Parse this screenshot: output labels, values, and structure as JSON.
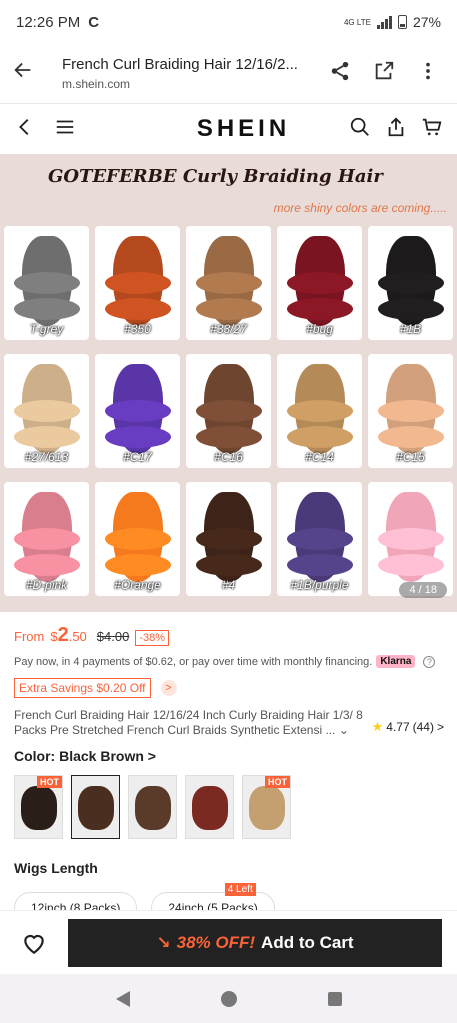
{
  "status_bar": {
    "time": "12:26 PM",
    "carrier_icon": "C",
    "network": "4G LTE",
    "battery": "27%"
  },
  "browser": {
    "page_title": "French Curl Braiding Hair 12/16/2...",
    "domain": "m.shein.com"
  },
  "shein_nav": {
    "logo": "SHEIN"
  },
  "product_image": {
    "banner_title": "GOTEFERBE Curly Braiding Hair",
    "banner_subtitle": "more shiny colors are coming.....",
    "counter": "4 / 18",
    "swatches": [
      {
        "label": "T-grey",
        "color": "#6e6e6e"
      },
      {
        "label": "#350",
        "color": "#b4491e"
      },
      {
        "label": "#33/27",
        "color": "#9a6a45"
      },
      {
        "label": "#bug",
        "color": "#7a1420"
      },
      {
        "label": "#1B",
        "color": "#1c1a1a"
      },
      {
        "label": "#27/613",
        "color": "#cdb08a"
      },
      {
        "label": "#C17",
        "color": "#5a35a8"
      },
      {
        "label": "#C16",
        "color": "#6e4630"
      },
      {
        "label": "#C14",
        "color": "#b48a58"
      },
      {
        "label": "#C15",
        "color": "#d2a07c"
      },
      {
        "label": "#D-pink",
        "color": "#d87e8c"
      },
      {
        "label": "#Orange",
        "color": "#f57a1e"
      },
      {
        "label": "#4",
        "color": "#3e2418"
      },
      {
        "label": "#1B/purple",
        "color": "#4a3a7a"
      },
      {
        "label": "",
        "color": "#f0a6b8"
      }
    ]
  },
  "price": {
    "from_label": "From",
    "currency": "$",
    "whole": "2",
    "cents": ".50",
    "original": "$4.00",
    "discount": "-38%"
  },
  "klarna": {
    "text": "Pay now, in 4 payments of $0.62, or pay over time with monthly financing.",
    "badge": "Klarna",
    "info": "?"
  },
  "savings": {
    "label": "Extra Savings $0.20 Off",
    "arrow": ">"
  },
  "product": {
    "title": "French Curl Braiding Hair 12/16/24 Inch Curly Braiding Hair 1/3/ 8 Packs Pre Stretched French Curl Braids Synthetic Extensi ...",
    "expand": "⌄",
    "rating": "4.77",
    "reviews": "(44)",
    "rating_arrow": ">"
  },
  "color": {
    "label": "Color: Black Brown >",
    "thumbs": [
      {
        "hot": "HOT",
        "color": "#2a1e18"
      },
      {
        "hot": "",
        "color": "#4a2e20"
      },
      {
        "hot": "",
        "color": "#5a3a28"
      },
      {
        "hot": "",
        "color": "#7a2a20"
      },
      {
        "hot": "HOT",
        "color": "#c4a070"
      }
    ]
  },
  "length": {
    "label": "Wigs Length",
    "options": [
      {
        "label": "12inch (8 Packs)",
        "badge": ""
      },
      {
        "label": "24inch (5 Packs)",
        "badge": "4 Left"
      }
    ]
  },
  "action_bar": {
    "promo": "38% OFF!",
    "cta": "Add to Cart"
  },
  "colors": {
    "accent": "#fa6338",
    "cta_bg": "#222222",
    "image_bg": "#e9dcd8"
  }
}
